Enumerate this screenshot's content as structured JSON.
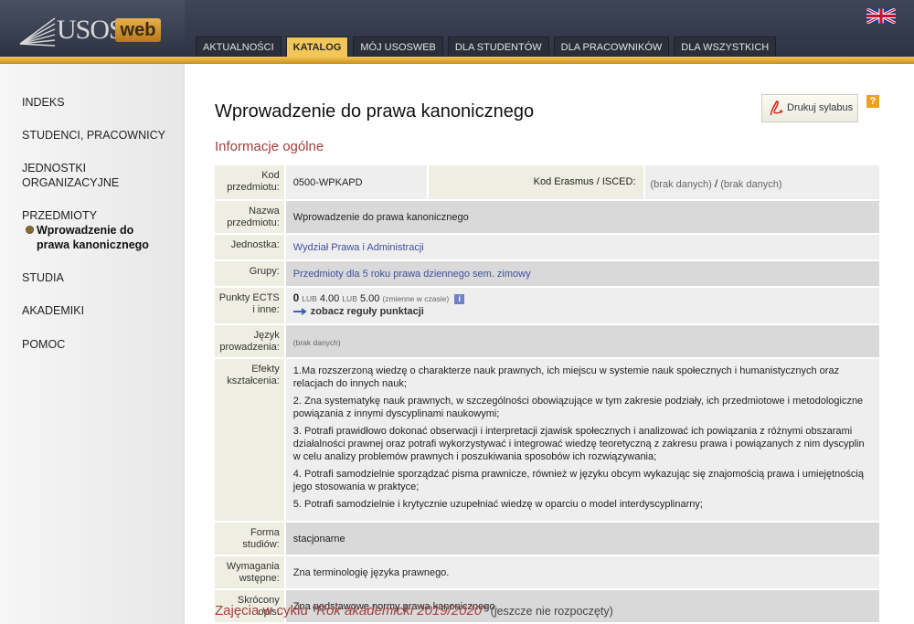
{
  "header": {
    "logo_text": "USOS",
    "logo_badge": "web",
    "tabs": [
      {
        "label": "AKTUALNOŚCI",
        "active": false
      },
      {
        "label": "KATALOG",
        "active": true
      },
      {
        "label": "MÓJ USOSWEB",
        "active": false
      },
      {
        "label": "DLA STUDENTÓW",
        "active": false
      },
      {
        "label": "DLA PRACOWNIKÓW",
        "active": false
      },
      {
        "label": "DLA WSZYSTKICH",
        "active": false
      }
    ],
    "language_flag": "uk-flag-icon"
  },
  "sidebar": {
    "items": [
      {
        "label": "INDEKS"
      },
      {
        "label": "STUDENCI, PRACOWNICY"
      },
      {
        "label": "JEDNOSTKI ORGANIZACYJNE"
      },
      {
        "label": "PRZEDMIOTY"
      },
      {
        "label": "STUDIA"
      },
      {
        "label": "AKADEMIKI"
      },
      {
        "label": "POMOC"
      }
    ],
    "sub_item": "Wprowadzenie do prawa kanonicznego"
  },
  "main": {
    "title": "Wprowadzenie do prawa kanonicznego",
    "print_label": "Drukuj sylabus",
    "help_label": "?",
    "section_general": "Informacje ogólne",
    "fields": {
      "code_label": "Kod przedmiotu:",
      "code_value": "0500-WPKAPD",
      "erasmus_label": "Kod Erasmus / ISCED:",
      "erasmus_value_1": "(brak danych)",
      "erasmus_sep": "/",
      "erasmus_value_2": "(brak danych)",
      "name_label": "Nazwa przedmiotu:",
      "name_value": "Wprowadzenie do prawa kanonicznego",
      "unit_label": "Jednostka:",
      "unit_value": "Wydział Prawa i Administracji",
      "groups_label": "Grupy:",
      "groups_value": "Przedmioty dla 5 roku prawa dziennego sem. zimowy",
      "ects_label": "Punkty ECTS i inne:",
      "ects_v1": "0",
      "ects_or1": "LUB",
      "ects_v2": "4.00",
      "ects_or2": "LUB",
      "ects_v3": "5.00",
      "ects_note": "(zmienne w czasie)",
      "ects_info": "i",
      "ects_rules": "zobacz reguły punktacji",
      "lang_label": "Język prowadzenia:",
      "lang_value": "(brak danych)",
      "outcomes_label": "Efekty kształcenia:",
      "outcomes": [
        "1.Ma rozszerzoną wiedzę o charakterze nauk prawnych, ich miejscu w systemie nauk społecznych i humanistycznych oraz relacjach do innych nauk;",
        "2. Zna systematykę nauk prawnych, w szczególności obowiązujące w tym zakresie podziały, ich przedmiotowe i metodologiczne powiązania z innymi dyscyplinami naukowymi;",
        "3. Potrafi prawidłowo dokonać obserwacji i interpretacji zjawisk społecznych i analizować ich powiązania z różnymi obszarami działalności prawnej oraz potrafi wykorzystywać i integrować wiedzę teoretyczną z zakresu prawa i powiązanych z nim dyscyplin w celu analizy problemów prawnych i poszukiwania sposobów ich rozwiązywania;",
        "4. Potrafi samodzielnie sporządzać pisma prawnicze, również w języku obcym wykazując się znajomością prawa i umiejętnością jego stosowania w praktyce;",
        "5. Potrafi samodzielnie i krytycznie uzupełniać wiedzę w oparciu o model interdyscyplinarny;"
      ],
      "form_label": "Forma studiów:",
      "form_value": "stacjonarne",
      "req_label": "Wymagania wstępne:",
      "req_value": "Zna terminologię języka prawnego.",
      "short_label": "Skrócony opis:",
      "short_value": "Zna podstawowe normy prawa kanonicznego."
    },
    "cycle": {
      "prefix": "Zajęcia w cyklu",
      "name": "\"Rok akademicki 2019/2020\"",
      "note": "(jeszcze nie rozpoczęty)"
    }
  },
  "colors": {
    "accent_gold": "#f2c75a",
    "section_red": "#a1403c",
    "link_blue": "#3e4fa0"
  }
}
